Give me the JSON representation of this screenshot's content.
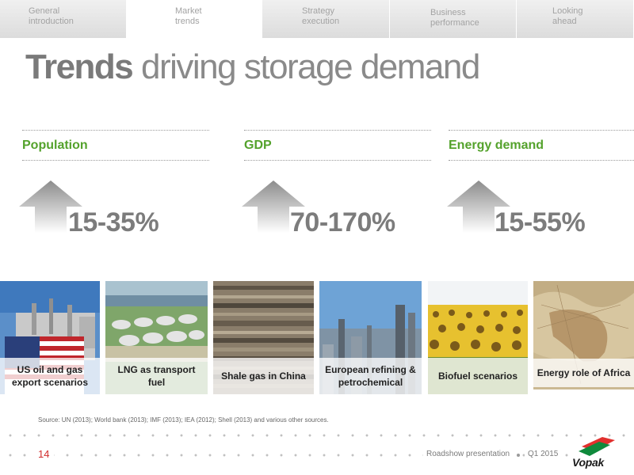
{
  "tabs": [
    {
      "label": "General\nintroduction",
      "active": false
    },
    {
      "label": "Market\ntrends",
      "active": true
    },
    {
      "label": "Strategy\nexecution",
      "active": false
    },
    {
      "label": "Business\nperformance",
      "active": false
    },
    {
      "label": "Looking\nahead",
      "active": false
    }
  ],
  "title": {
    "bold": "Trends",
    "rest": " driving storage demand"
  },
  "metrics": [
    {
      "label": "Population",
      "value": "15-35%"
    },
    {
      "label": "GDP",
      "value": "70-170%"
    },
    {
      "label": "Energy demand",
      "value": "15-55%"
    }
  ],
  "tiles": [
    {
      "caption": "US oil and gas export scenarios"
    },
    {
      "caption": "LNG as transport fuel"
    },
    {
      "caption": "Shale gas in China"
    },
    {
      "caption": "European refining & petrochemical"
    },
    {
      "caption": "Biofuel scenarios"
    },
    {
      "caption": "Energy role of Africa"
    }
  ],
  "source": "Source: UN (2013); World bank (2013); IMF (2013); IEA (2012); Shell (2013) and various other sources.",
  "footer": {
    "page_number": "14",
    "presentation": "Roadshow presentation",
    "period": "Q1 2015",
    "logo_text": "Vopak"
  },
  "colors": {
    "accent_green": "#54a22c",
    "page_number_red": "#d12d2d",
    "value_grey": "#7c7c7c"
  },
  "icons": [
    "up-arrow-icon",
    "vopak-logo"
  ]
}
